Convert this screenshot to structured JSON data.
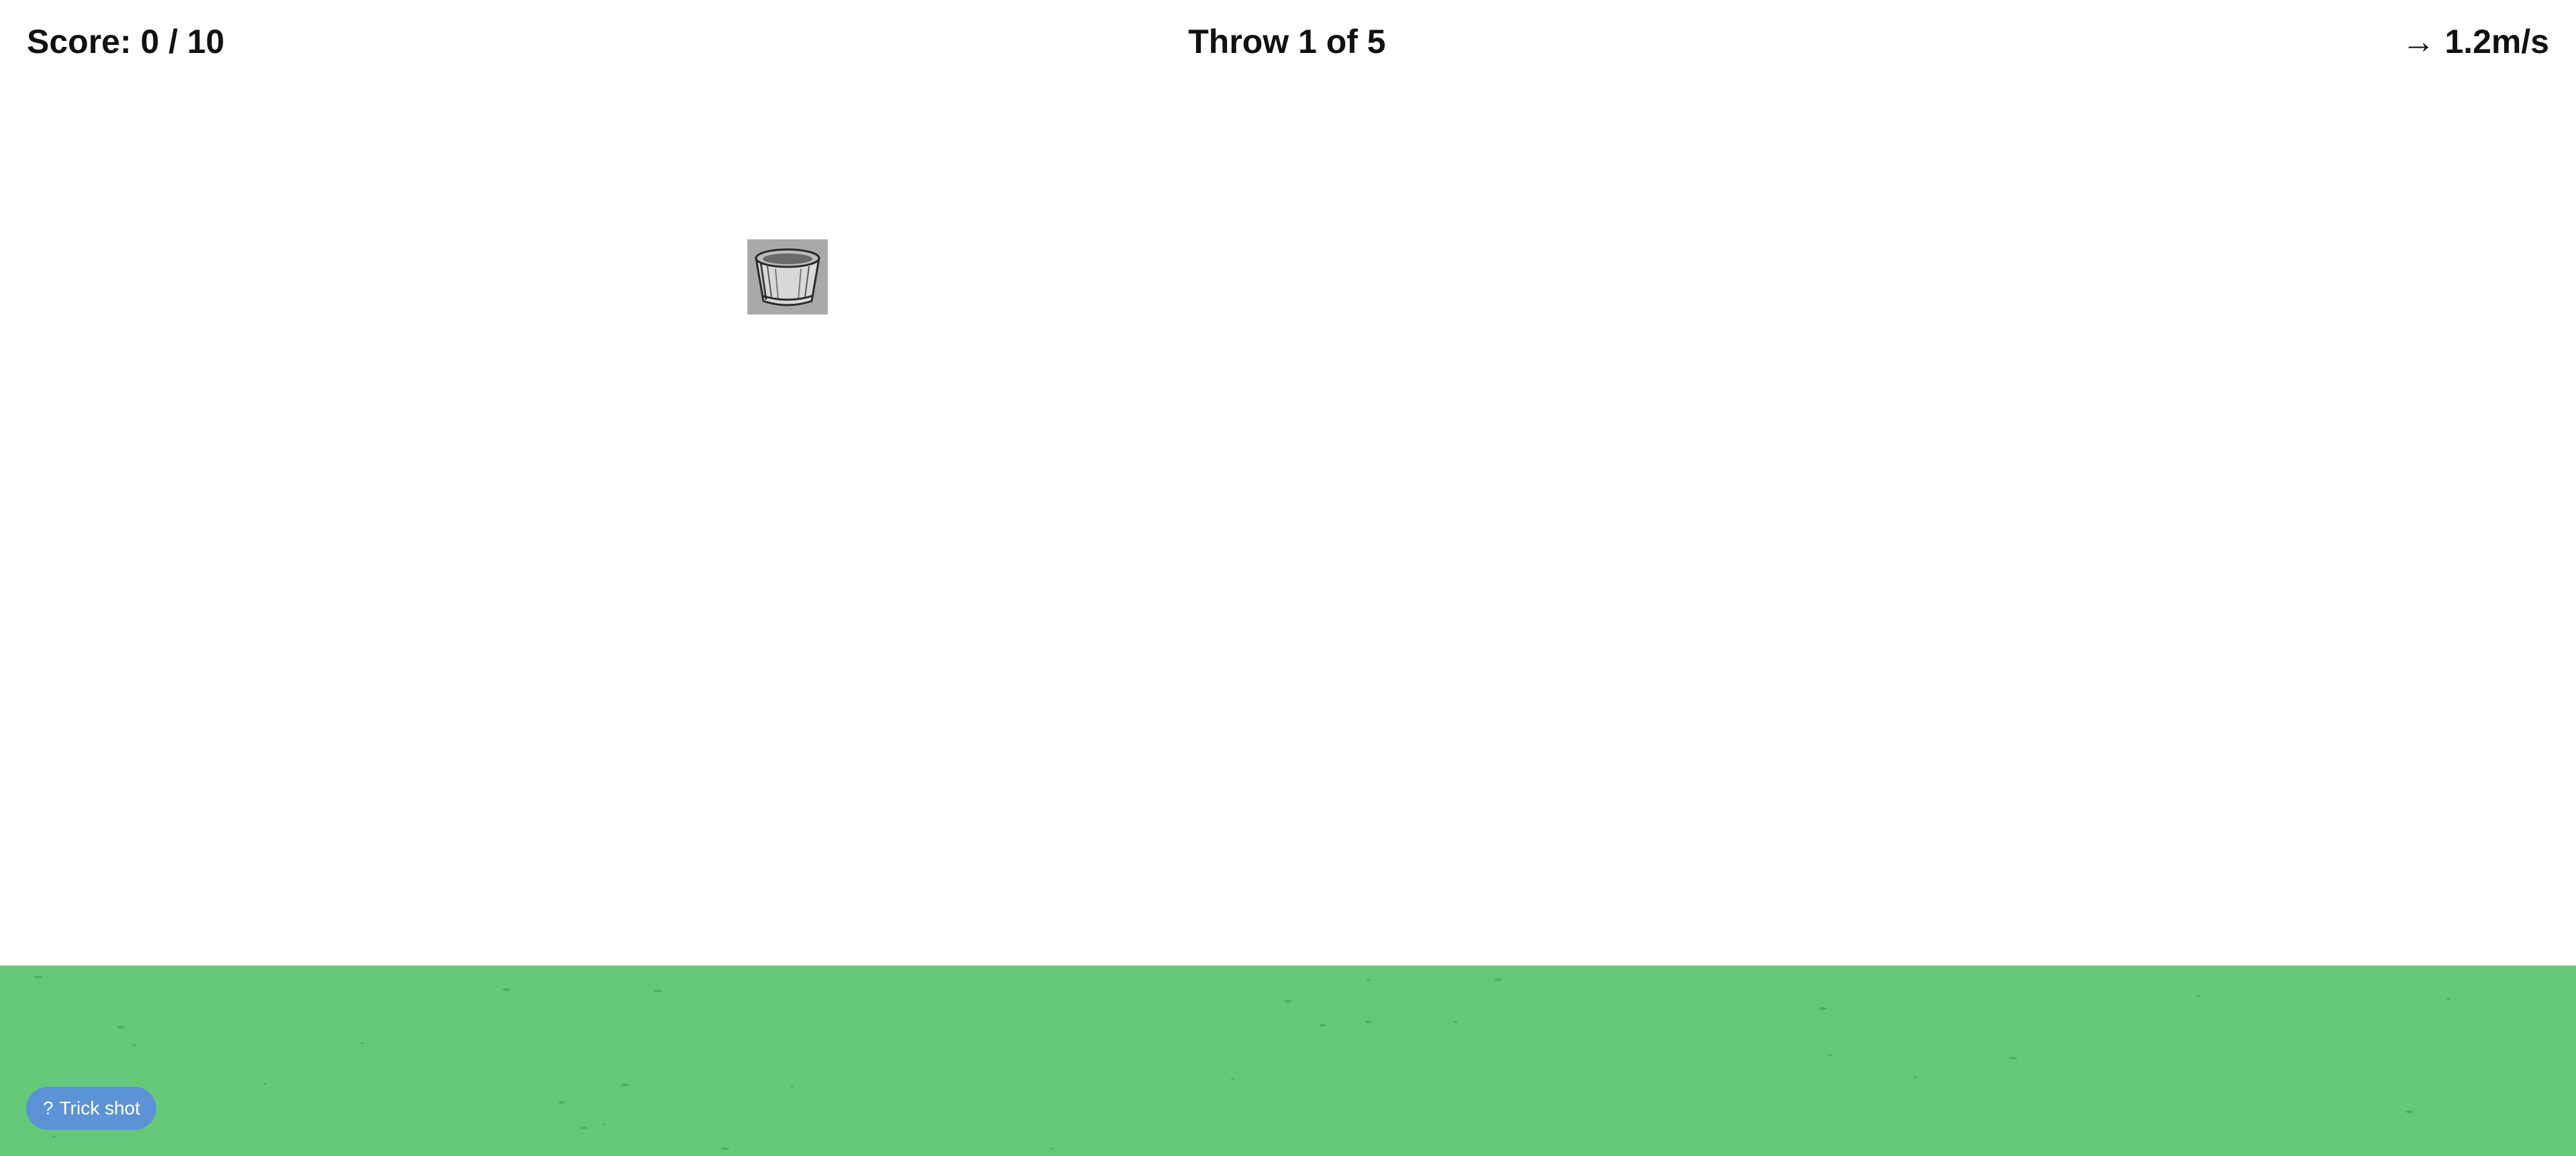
{
  "hud": {
    "score_label": "Score: 0 / 10",
    "throw_label": "Throw 1 of 5",
    "wind": {
      "arrow_icon": "right-arrow-icon",
      "arrow_glyph": "→",
      "speed_label": "1.2m/s"
    }
  },
  "target": {
    "icon": "bucket-icon"
  },
  "controls": {
    "trick_shot": {
      "icon_glyph": "?",
      "label": "Trick shot"
    }
  },
  "colors": {
    "background": "#ffffff",
    "grass": "#66c97a",
    "grass_blade": "#4fae64",
    "bucket_tile": "#a9a9a9",
    "button": "#5b93d6",
    "text": "#111111"
  }
}
